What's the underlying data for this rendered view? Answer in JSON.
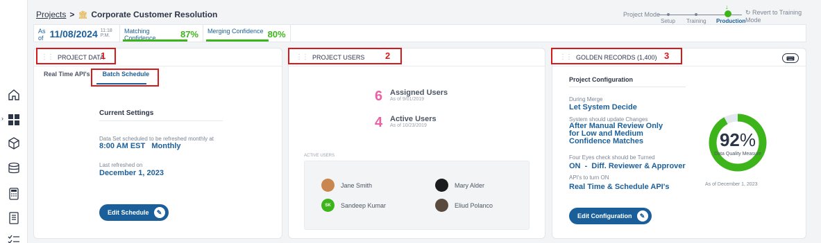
{
  "breadcrumb": {
    "parent": "Projects",
    "separator": ">",
    "current": "Corporate Customer Resolution"
  },
  "mode": {
    "label": "Project Mode",
    "steps": [
      "Setup",
      "Training",
      "Production"
    ],
    "active_step": "Production",
    "revert": "Revert to Training Mode"
  },
  "metrics": {
    "asof_label": "As of",
    "asof_date": "11/08/2024",
    "asof_time": "11:18 P.M.",
    "matching_label": "Matching Confidence",
    "matching_value": "87%",
    "merging_label": "Merging Confidence",
    "merging_value": "80%"
  },
  "callouts": [
    "1",
    "2",
    "3"
  ],
  "project_data": {
    "title": "PROJECT DATA",
    "tabs": [
      "Real Time API's",
      "Batch Schedule"
    ],
    "settings_title": "Current Settings",
    "schedule_label": "Data Set scheduled to be refreshed monthly at",
    "schedule_value": "8:00 AM EST   Monthly",
    "refreshed_label": "Last refreshed on",
    "refreshed_value": "December 1, 2023",
    "edit_button": "Edit Schedule"
  },
  "project_users": {
    "title": "PROJECT USERS",
    "assigned_count": "6",
    "assigned_label": "Assigned Users",
    "assigned_date": "As of 9/01/2019",
    "active_count": "4",
    "active_label": "Active Users",
    "active_date": "As of 10/23/2019",
    "active_users_label": "ACTIVE USERS",
    "users": [
      {
        "name": "Jane Smith",
        "initials": ""
      },
      {
        "name": "Mary Alder",
        "initials": ""
      },
      {
        "name": "Sandeep Kumar",
        "initials": "SK"
      },
      {
        "name": "Eliud Polanco",
        "initials": ""
      }
    ]
  },
  "golden_records": {
    "title": "GOLDEN RECORDS (1,400)",
    "config_title": "Project Configuration",
    "items": [
      {
        "label": "During Merge",
        "value": "Let System Decide"
      },
      {
        "label": "System should update Changes",
        "value": "After Manual Review Only for Low and Medium Confidence Matches"
      },
      {
        "label": "Four Eyes check should be Turned",
        "value": "ON  -  Diff. Reviewer & Approver"
      },
      {
        "label": "API's to turn ON",
        "value": "Real Time & Schedule API's"
      }
    ],
    "gauge_value": "92",
    "gauge_unit": "%",
    "gauge_label": "Data Quality Measure",
    "gauge_fraction": 0.92,
    "asof": "As of December 1, 2023",
    "edit_button": "Edit Configuration"
  },
  "colors": {
    "primary": "#1b5f9a",
    "success": "#3db51a",
    "accent_pink": "#ec5fa4",
    "callout": "#d7191c"
  },
  "icons": [
    "home-icon",
    "dashboard-grid-icon",
    "cube-icon",
    "database-icon",
    "calculator-icon",
    "notebook-icon",
    "checklist-icon"
  ]
}
